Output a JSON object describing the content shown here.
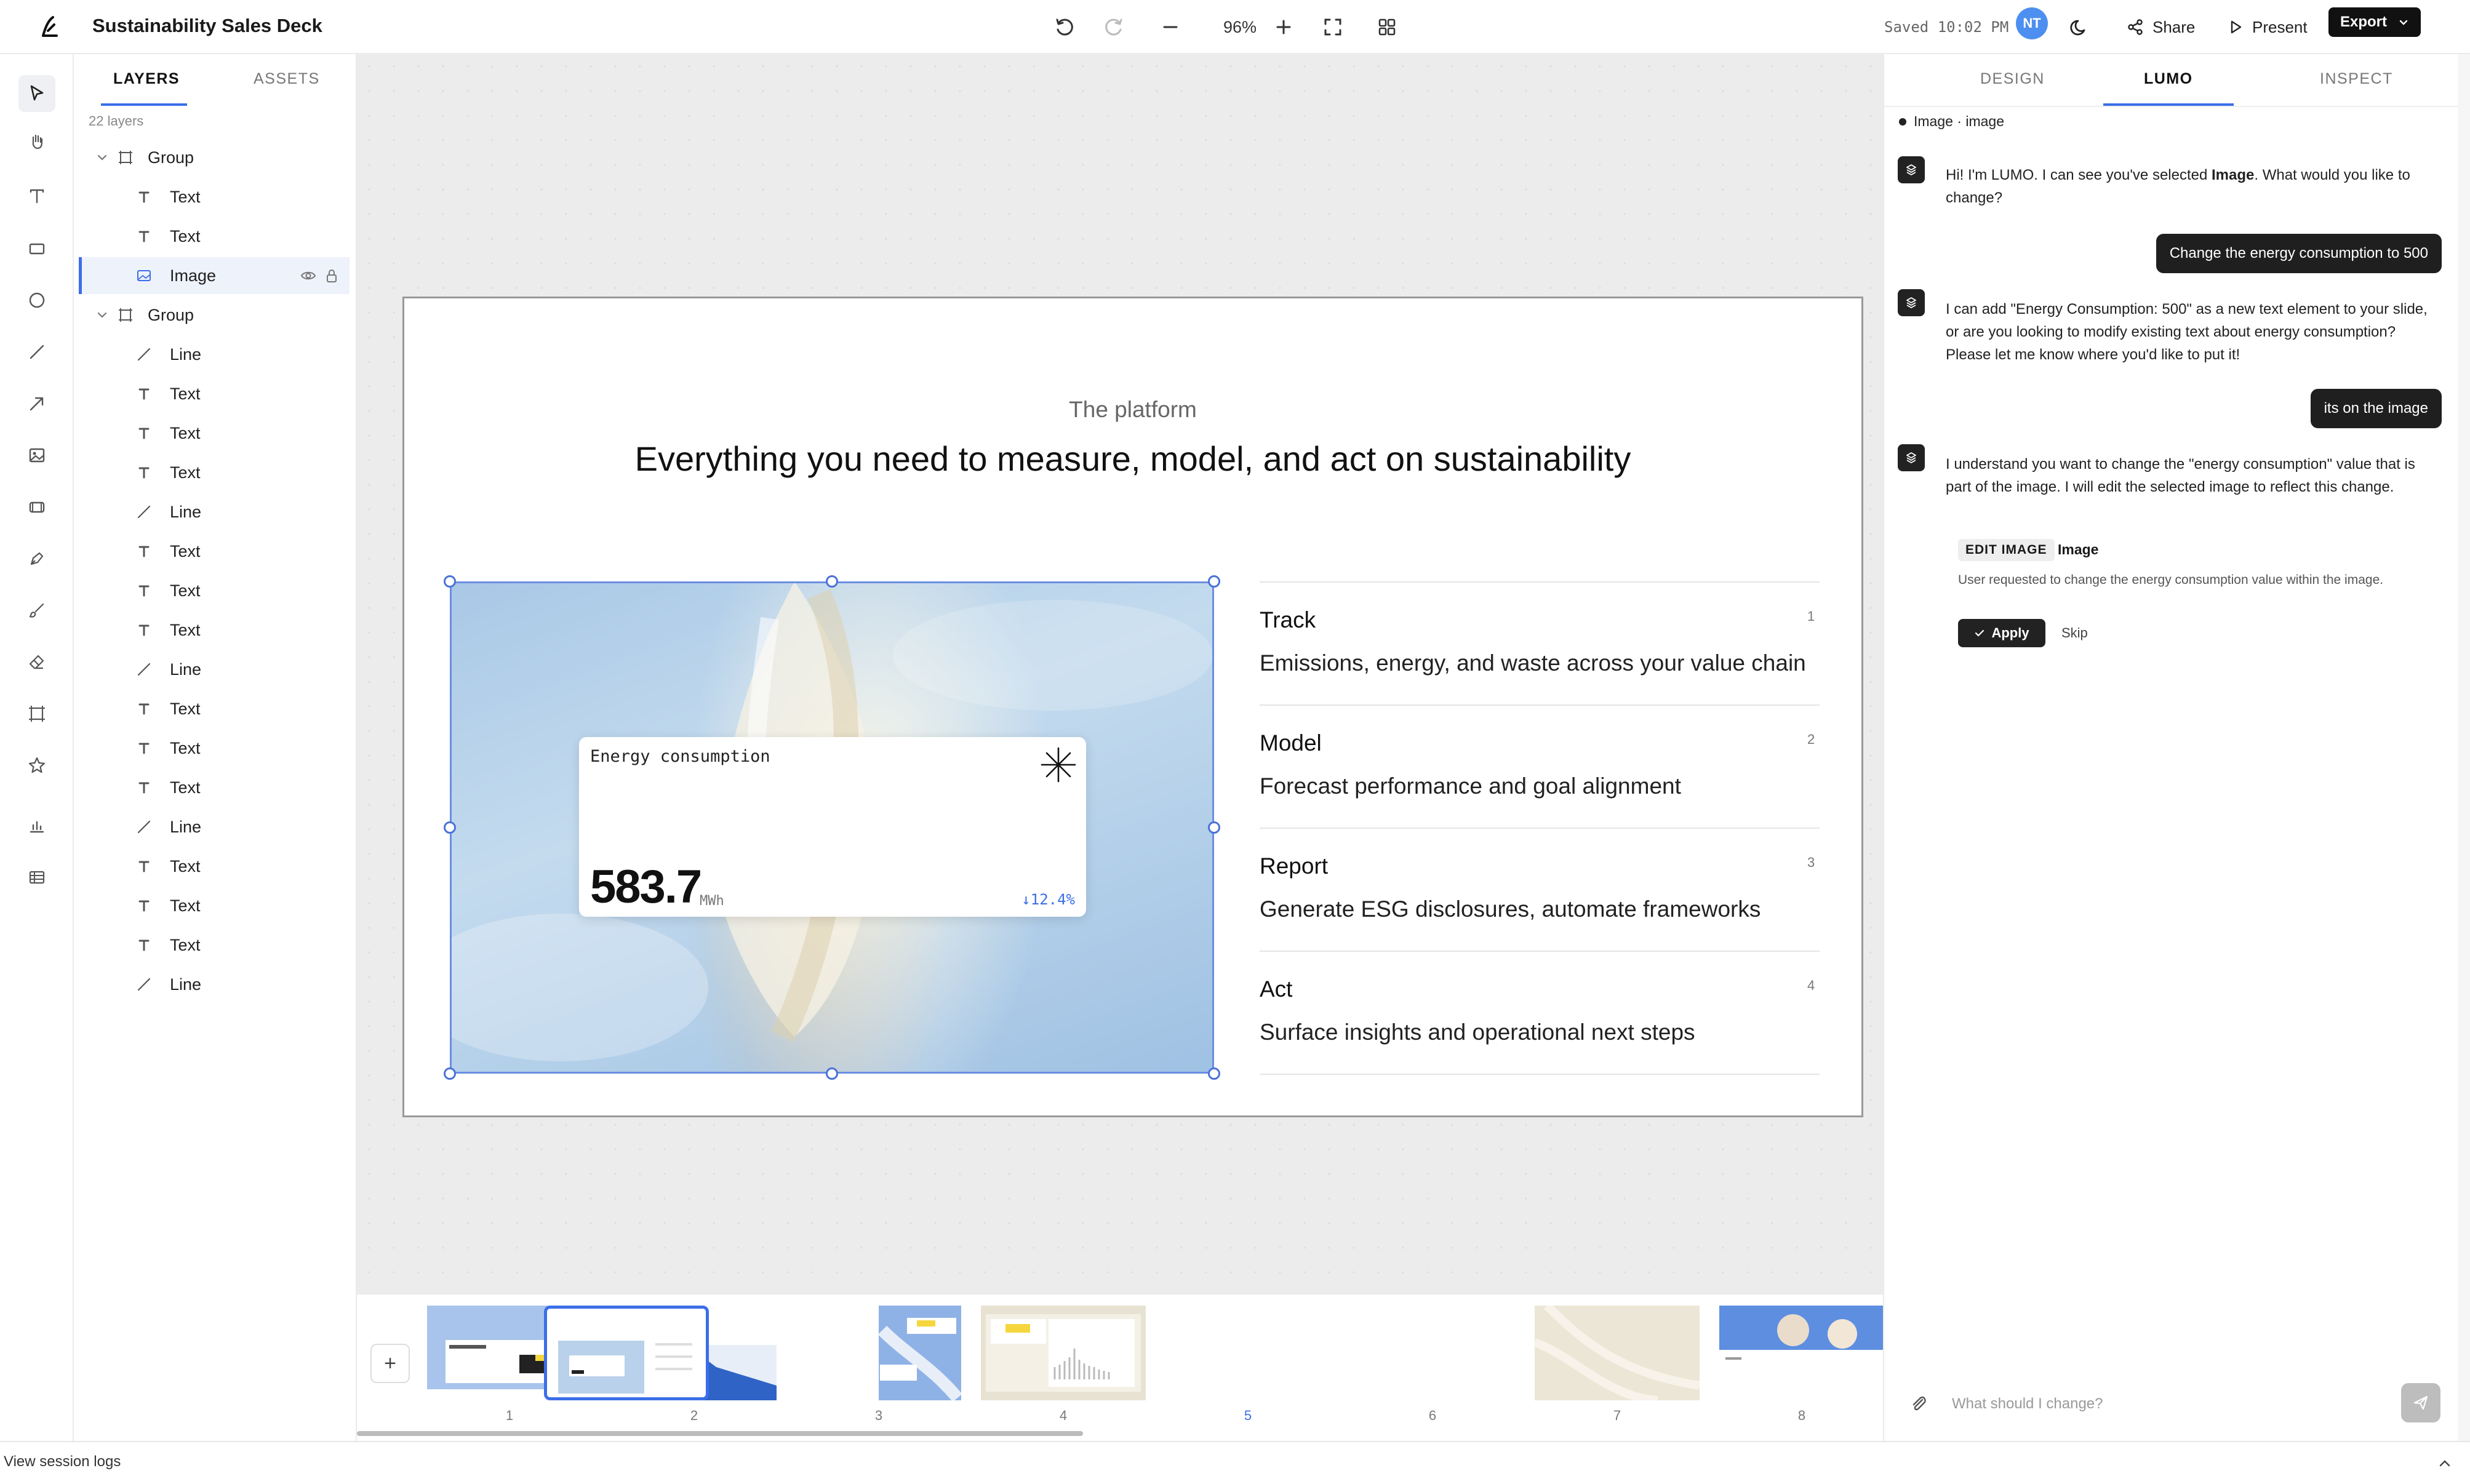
{
  "app": {
    "title": "Sustainability Sales Deck",
    "zoom": "96%",
    "saved": "Saved 10:02 PM",
    "avatar_initials": "NT",
    "share_label": "Share",
    "present_label": "Present",
    "export_label": "Export"
  },
  "colors": {
    "accent": "#3b6ee8",
    "dark": "#1f1f1f",
    "avatar": "#4d8ff0"
  },
  "tools": [
    "select-icon",
    "hand-icon",
    "text-tool-icon",
    "rectangle-tool-icon",
    "ellipse-tool-icon",
    "line-tool-icon",
    "arrow-tool-icon",
    "image-tool-icon",
    "video-tool-icon",
    "pen-tool-icon",
    "brush-tool-icon",
    "eraser-tool-icon",
    "frame-tool-icon",
    "star-tool-icon",
    "chart-tool-icon",
    "table-tool-icon"
  ],
  "layers_panel": {
    "tab_layers": "LAYERS",
    "tab_assets": "ASSETS",
    "count": "22 layers",
    "rows": [
      {
        "name": "Group",
        "type": "group"
      },
      {
        "name": "Text",
        "type": "text"
      },
      {
        "name": "Text",
        "type": "text"
      },
      {
        "name": "Image",
        "type": "image",
        "selected": true
      },
      {
        "name": "Group",
        "type": "group"
      },
      {
        "name": "Line",
        "type": "line"
      },
      {
        "name": "Text",
        "type": "text"
      },
      {
        "name": "Text",
        "type": "text"
      },
      {
        "name": "Text",
        "type": "text"
      },
      {
        "name": "Line",
        "type": "line"
      },
      {
        "name": "Text",
        "type": "text"
      },
      {
        "name": "Text",
        "type": "text"
      },
      {
        "name": "Text",
        "type": "text"
      },
      {
        "name": "Line",
        "type": "line"
      },
      {
        "name": "Text",
        "type": "text"
      },
      {
        "name": "Text",
        "type": "text"
      },
      {
        "name": "Text",
        "type": "text"
      },
      {
        "name": "Line",
        "type": "line"
      },
      {
        "name": "Text",
        "type": "text"
      },
      {
        "name": "Text",
        "type": "text"
      },
      {
        "name": "Text",
        "type": "text"
      },
      {
        "name": "Line",
        "type": "line"
      }
    ]
  },
  "slide": {
    "eyebrow": "The platform",
    "title": "Everything you need to measure, model, and act on sustainability",
    "card": {
      "title": "Energy consumption",
      "value": "583.7",
      "unit": "MWh",
      "delta": "↓12.4%"
    },
    "features": [
      {
        "name": "Track",
        "num": "1",
        "desc": "Emissions, energy, and waste across your value chain"
      },
      {
        "name": "Model",
        "num": "2",
        "desc": "Forecast performance and goal alignment"
      },
      {
        "name": "Report",
        "num": "3",
        "desc": "Generate ESG disclosures, automate frameworks"
      },
      {
        "name": "Act",
        "num": "4",
        "desc": "Surface insights and operational next steps"
      }
    ]
  },
  "filmstrip": {
    "add_label": "+",
    "slides": [
      "1",
      "2",
      "3",
      "4",
      "5",
      "6",
      "7",
      "8"
    ],
    "active": "5"
  },
  "lumo": {
    "tab_design": "DESIGN",
    "tab_lumo": "LUMO",
    "tab_inspect": "INSPECT",
    "context": "Image · image",
    "bot_msg_1_pre": "Hi! I'm LUMO. I can see you've selected ",
    "bot_msg_1_bold": "Image",
    "bot_msg_1_post": ". What would you like to change?",
    "user_msg_1": "Change the energy consumption to 500",
    "bot_msg_2": "I can add \"Energy Consumption: 500\" as a new text element to your slide, or are you looking to modify existing text about energy consumption? Please let me know where you'd like to put it!",
    "user_msg_2": "its on the image",
    "bot_msg_3": "I understand you want to change the \"energy consumption\" value that is part of the image. I will edit the selected image to reflect this change.",
    "edit_chip": "EDIT IMAGE",
    "edit_target": "Image",
    "edit_desc": "User requested to change the energy consumption value within the image.",
    "apply_label": "Apply",
    "skip_label": "Skip",
    "input_placeholder": "What should I change?"
  },
  "bottom": {
    "session_logs": "View session logs"
  }
}
